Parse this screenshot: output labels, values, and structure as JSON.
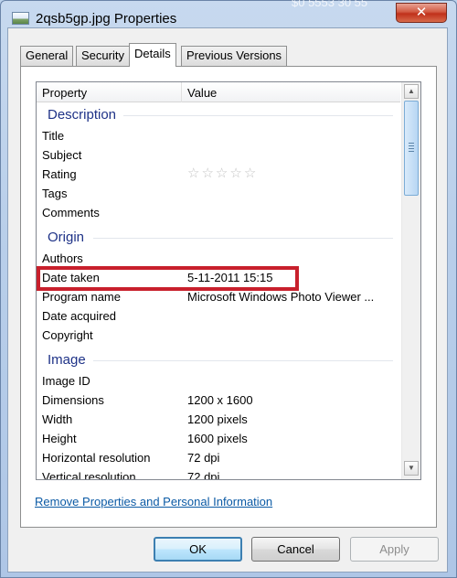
{
  "window": {
    "title": "2qsb5gp.jpg Properties",
    "title_overlap": "$0 5553 30 55",
    "close_glyph": "✕"
  },
  "tabs": [
    "General",
    "Security",
    "Details",
    "Previous Versions"
  ],
  "active_tab": "Details",
  "columns": {
    "property": "Property",
    "value": "Value"
  },
  "groups": {
    "description": {
      "label": "Description",
      "rows": [
        {
          "name": "Title",
          "value": ""
        },
        {
          "name": "Subject",
          "value": ""
        },
        {
          "name": "Rating",
          "value": "",
          "stars": 0,
          "star_max": 5
        },
        {
          "name": "Tags",
          "value": ""
        },
        {
          "name": "Comments",
          "value": ""
        }
      ]
    },
    "origin": {
      "label": "Origin",
      "rows": [
        {
          "name": "Authors",
          "value": ""
        },
        {
          "name": "Date taken",
          "value": "5-11-2011 15:15"
        },
        {
          "name": "Program name",
          "value": "Microsoft Windows Photo Viewer ..."
        },
        {
          "name": "Date acquired",
          "value": ""
        },
        {
          "name": "Copyright",
          "value": ""
        }
      ]
    },
    "image": {
      "label": "Image",
      "rows": [
        {
          "name": "Image ID",
          "value": ""
        },
        {
          "name": "Dimensions",
          "value": "1200 x 1600"
        },
        {
          "name": "Width",
          "value": "1200 pixels"
        },
        {
          "name": "Height",
          "value": "1600 pixels"
        },
        {
          "name": "Horizontal resolution",
          "value": "72 dpi"
        },
        {
          "name": "Vertical resolution",
          "value": "72 dpi"
        }
      ]
    }
  },
  "link": "Remove Properties and Personal Information",
  "buttons": {
    "ok": "OK",
    "cancel": "Cancel",
    "apply": "Apply"
  },
  "icons": {
    "star": "☆",
    "scroll_up": "▲",
    "scroll_down": "▼"
  },
  "colors": {
    "highlight": "#c8202c",
    "group_label": "#1e3287",
    "link": "#0b5aa5"
  }
}
